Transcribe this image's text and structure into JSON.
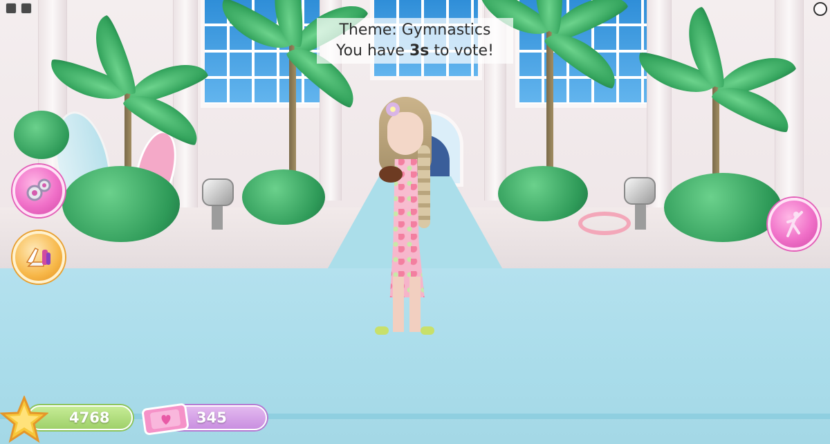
{
  "theme": {
    "label": "Theme:",
    "value": "Gymnastics",
    "vote_prefix": "You have",
    "seconds": "3s",
    "vote_suffix": "to vote!"
  },
  "currencies": {
    "stars": "4768",
    "tickets": "345"
  },
  "buttons": {
    "left_top": "settings-gears-icon",
    "left_bottom": "outfit-shoes-icon",
    "right": "pose-dancer-icon"
  },
  "colors": {
    "pink_button": "#f070c8",
    "gold_button": "#f7b84a",
    "star_bar": "#9fd06a",
    "ticket_bar": "#c98fe0",
    "runway": "#aadcea"
  }
}
